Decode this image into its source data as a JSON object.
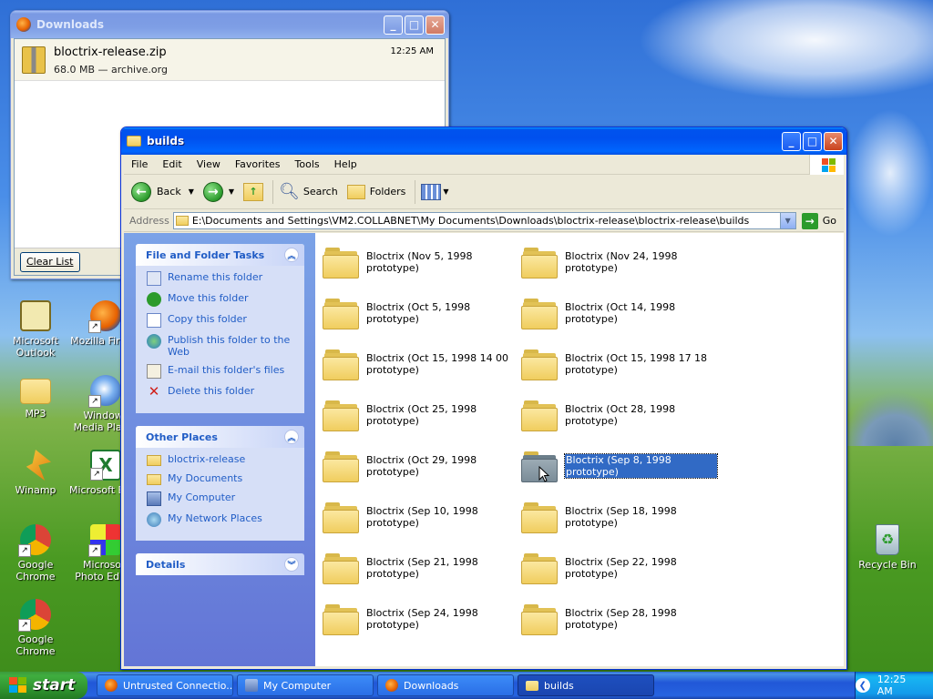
{
  "desktop": {
    "icons": [
      {
        "label": "Microsoft Outlook",
        "icon": "outlook-icon"
      },
      {
        "label": "Mozilla Firefox",
        "icon": "firefox-icon"
      },
      {
        "label": "MP3",
        "icon": "folder-icon"
      },
      {
        "label": "Windows Media Player",
        "icon": "media-player-icon"
      },
      {
        "label": "Winamp",
        "icon": "winamp-icon"
      },
      {
        "label": "Microsoft Excel",
        "icon": "excel-icon"
      },
      {
        "label": "Google Chrome",
        "icon": "chrome-icon"
      },
      {
        "label": "Microsoft Photo Editor",
        "icon": "photo-editor-icon"
      },
      {
        "label": "Google Chrome",
        "icon": "chrome-icon"
      },
      {
        "label": "Recycle Bin",
        "icon": "recycle-bin-icon"
      }
    ]
  },
  "downloads": {
    "title": "Downloads",
    "item": {
      "name": "bloctrix-release.zip",
      "meta": "68.0 MB — archive.org",
      "time": "12:25 AM"
    },
    "clear_label": "Clear List"
  },
  "explorer": {
    "title": "builds",
    "menu": [
      "File",
      "Edit",
      "View",
      "Favorites",
      "Tools",
      "Help"
    ],
    "toolbar": {
      "back": "Back",
      "search": "Search",
      "folders": "Folders"
    },
    "address": {
      "label": "Address",
      "path": "E:\\Documents and Settings\\VM2.COLLABNET\\My Documents\\Downloads\\bloctrix-release\\bloctrix-release\\builds",
      "go": "Go"
    },
    "tasks": {
      "title": "File and Folder Tasks",
      "items": [
        "Rename this folder",
        "Move this folder",
        "Copy this folder",
        "Publish this folder to the Web",
        "E-mail this folder's files",
        "Delete this folder"
      ]
    },
    "places": {
      "title": "Other Places",
      "items": [
        "bloctrix-release",
        "My Documents",
        "My Computer",
        "My Network Places"
      ]
    },
    "details": {
      "title": "Details"
    },
    "folders": [
      {
        "line1": "Bloctrix (Nov 5, 1998 prototype)",
        "line2": ""
      },
      {
        "line1": "Bloctrix (Nov 24, 1998",
        "line2": "prototype)"
      },
      {
        "line1": "Bloctrix (Oct 5, 1998 prototype)",
        "line2": ""
      },
      {
        "line1": "Bloctrix (Oct 14, 1998",
        "line2": "prototype)"
      },
      {
        "line1": "Bloctrix (Oct 15, 1998 14 00",
        "line2": "prototype)"
      },
      {
        "line1": "Bloctrix (Oct 15, 1998 17 18",
        "line2": "prototype)"
      },
      {
        "line1": "Bloctrix (Oct 25, 1998",
        "line2": "prototype)"
      },
      {
        "line1": "Bloctrix (Oct 28, 1998",
        "line2": "prototype)"
      },
      {
        "line1": "Bloctrix (Oct 29, 1998",
        "line2": "prototype)"
      },
      {
        "line1": "Bloctrix (Sep 8, 1998 prototype)",
        "line2": "",
        "selected": true
      },
      {
        "line1": "Bloctrix (Sep 10, 1998",
        "line2": "prototype)"
      },
      {
        "line1": "Bloctrix (Sep 18, 1998",
        "line2": "prototype)"
      },
      {
        "line1": "Bloctrix (Sep 21, 1998",
        "line2": "prototype)"
      },
      {
        "line1": "Bloctrix (Sep 22, 1998",
        "line2": "prototype)"
      },
      {
        "line1": "Bloctrix (Sep 24, 1998",
        "line2": "prototype)"
      },
      {
        "line1": "Bloctrix (Sep 28, 1998",
        "line2": "prototype)"
      }
    ]
  },
  "taskbar": {
    "start": "start",
    "items": [
      {
        "label": "Untrusted Connectio...",
        "icon": "firefox-icon"
      },
      {
        "label": "My Computer",
        "icon": "my-computer-icon"
      },
      {
        "label": "Downloads",
        "icon": "firefox-icon"
      },
      {
        "label": "builds",
        "icon": "folder-icon",
        "active": true
      }
    ],
    "clock": "12:25 AM"
  }
}
